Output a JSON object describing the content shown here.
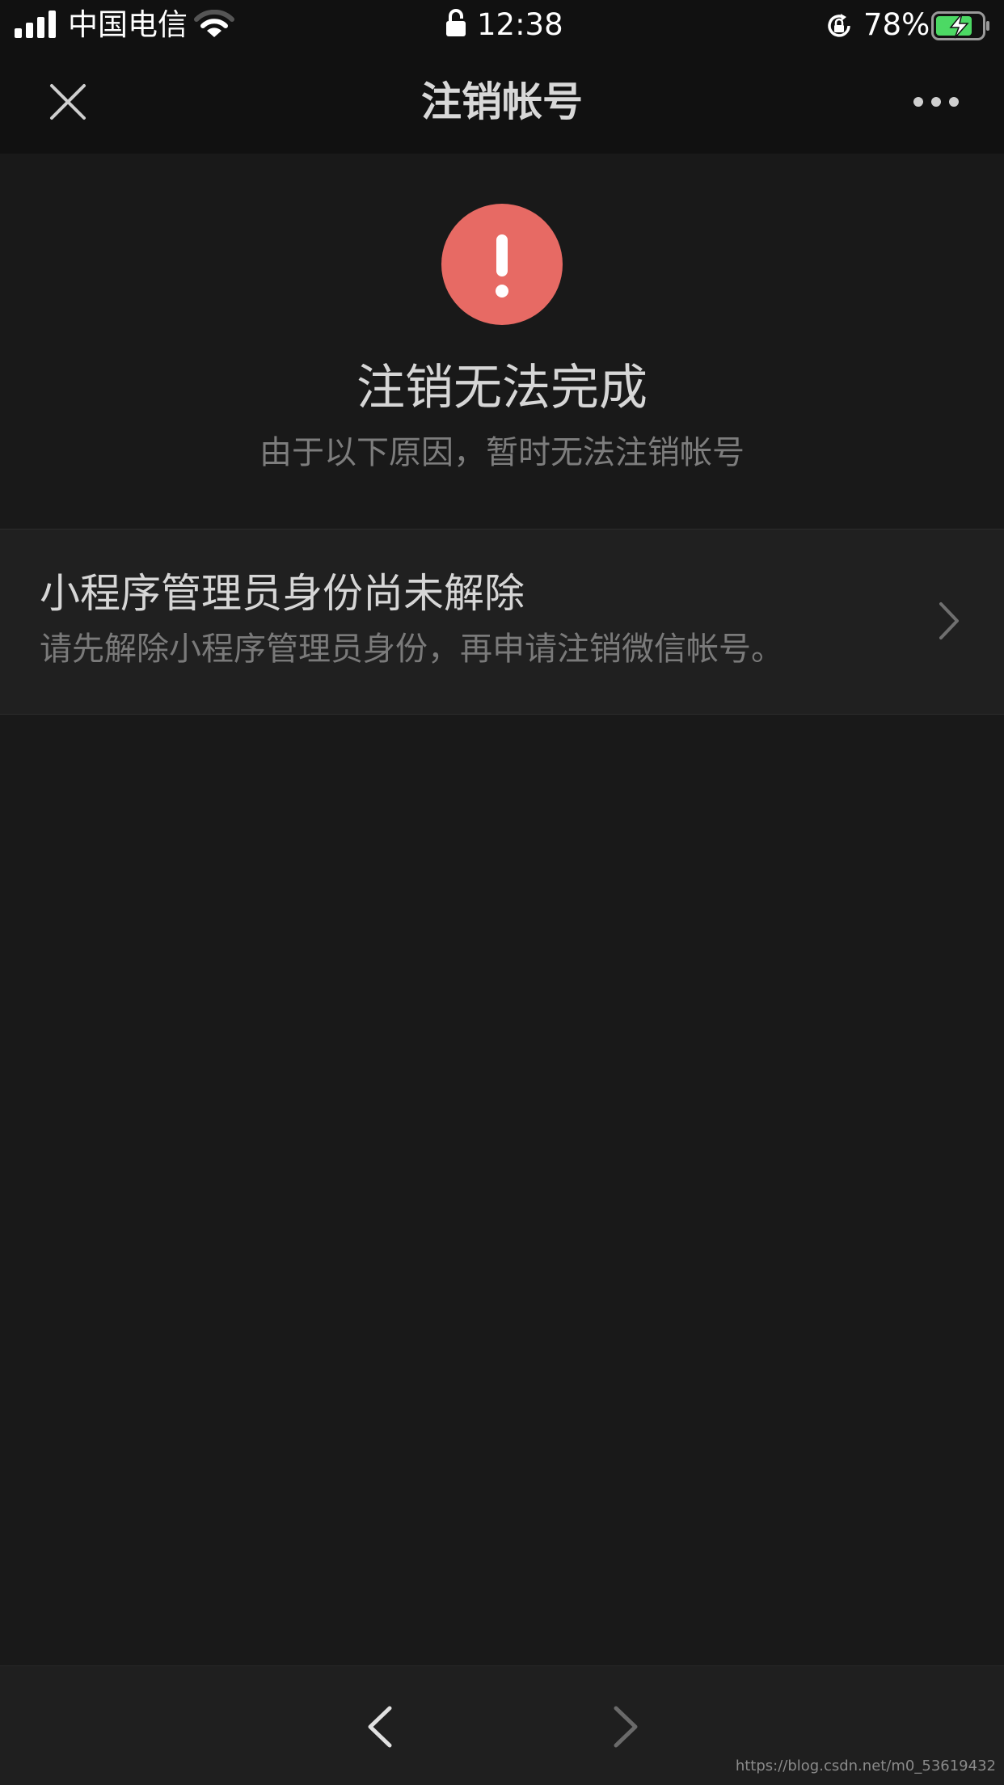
{
  "status_bar": {
    "carrier": "中国电信",
    "time": "12:38",
    "battery_percent": "78%",
    "battery_level": 0.78,
    "icons": [
      "signal-icon",
      "wifi-icon",
      "lock-icon",
      "rotation-lock-icon",
      "battery-charging-icon"
    ]
  },
  "nav_bar": {
    "title": "注销帐号",
    "icons": [
      "close-icon",
      "more-icon"
    ]
  },
  "result": {
    "icon": "warning-icon",
    "icon_color": "#e76a64",
    "title": "注销无法完成",
    "description": "由于以下原因，暂时无法注销帐号"
  },
  "reasons": [
    {
      "title": "小程序管理员身份尚未解除",
      "description": "请先解除小程序管理员身份，再申请注销微信帐号。",
      "icon": "chevron-right-icon"
    }
  ],
  "toolbar": {
    "icons": [
      "back-arrow-icon",
      "forward-arrow-icon"
    ]
  },
  "watermark": "https://blog.csdn.net/m0_53619432",
  "colors": {
    "background": "#191919",
    "bar_background": "#111111",
    "cell_background": "#202020",
    "battery_green": "#4cd964"
  }
}
